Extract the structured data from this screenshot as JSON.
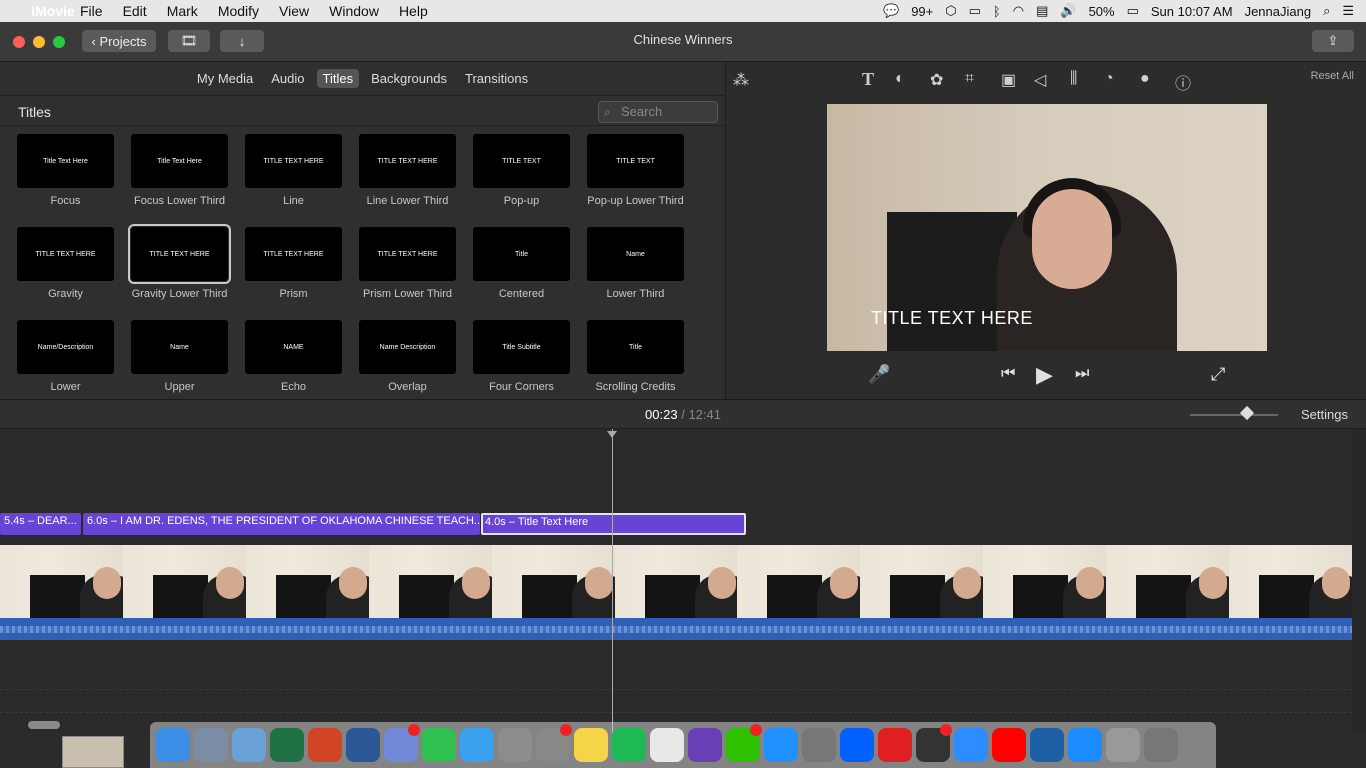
{
  "menubar": {
    "app": "iMovie",
    "items": [
      "File",
      "Edit",
      "Mark",
      "Modify",
      "View",
      "Window",
      "Help"
    ],
    "wechat_count": "99+",
    "battery": "50%",
    "clock": "Sun 10:07 AM",
    "user": "JennaJiang"
  },
  "window": {
    "title": "Chinese Winners",
    "projects_label": "Projects"
  },
  "browser": {
    "tabs": [
      "My Media",
      "Audio",
      "Titles",
      "Backgrounds",
      "Transitions"
    ],
    "selected_tab": "Titles",
    "header": "Titles",
    "search_placeholder": "Search",
    "titles": [
      {
        "name": "Focus",
        "preview": "Title Text Here"
      },
      {
        "name": "Focus Lower Third",
        "preview": "Title Text Here"
      },
      {
        "name": "Line",
        "preview": "TITLE TEXT HERE"
      },
      {
        "name": "Line Lower Third",
        "preview": "TITLE TEXT HERE"
      },
      {
        "name": "Pop-up",
        "preview": "TITLE TEXT"
      },
      {
        "name": "Pop-up Lower Third",
        "preview": "TITLE TEXT"
      },
      {
        "name": "Gravity",
        "preview": "TITLE TEXT HERE"
      },
      {
        "name": "Gravity Lower Third",
        "preview": "TITLE TEXT HERE"
      },
      {
        "name": "Prism",
        "preview": "TITLE TEXT HERE"
      },
      {
        "name": "Prism Lower Third",
        "preview": "TITLE TEXT HERE"
      },
      {
        "name": "Centered",
        "preview": "Title"
      },
      {
        "name": "Lower Third",
        "preview": "Name"
      },
      {
        "name": "Lower",
        "preview": "Name/Description"
      },
      {
        "name": "Upper",
        "preview": "Name"
      },
      {
        "name": "Echo",
        "preview": "NAME"
      },
      {
        "name": "Overlap",
        "preview": "Name Description"
      },
      {
        "name": "Four Corners",
        "preview": "Title Subtitle"
      },
      {
        "name": "Scrolling Credits",
        "preview": "Title"
      }
    ],
    "selected_title": "Gravity Lower Third"
  },
  "viewer": {
    "reset_label": "Reset All",
    "overlay_text": "TITLE TEXT HERE",
    "colors": {
      "title_clip": "#6744d6",
      "audio": "#2f5fb6"
    }
  },
  "timeline": {
    "current_time": "00:23",
    "separator": "/",
    "total_time": "12:41",
    "settings_label": "Settings",
    "title_clips": [
      {
        "label": "5.4s – DEAR...",
        "selected": false
      },
      {
        "label": "6.0s – I AM DR. EDENS, THE PRESIDENT OF OKLAHOMA CHINESE TEACH...",
        "selected": false
      },
      {
        "label": "4.0s – Title Text Here",
        "selected": true
      }
    ]
  },
  "dock": {
    "apps": [
      "finder-icon",
      "launchpad-icon",
      "preview-icon",
      "excel-icon",
      "powerpoint-icon",
      "word-icon",
      "discord-icon",
      "facetime-icon",
      "messages-icon",
      "calculator-icon",
      "system-preferences-icon",
      "notes-icon",
      "spotify-icon",
      "chrome-icon",
      "imovie-icon",
      "wechat-icon",
      "safari-icon",
      "quotes-icon",
      "dropbox-icon",
      "screen-icon",
      "photobooth-icon",
      "zoom-icon",
      "youtube-icon",
      "quicktime-icon",
      "app-store-icon",
      "printer-icon",
      "trash-icon"
    ]
  }
}
